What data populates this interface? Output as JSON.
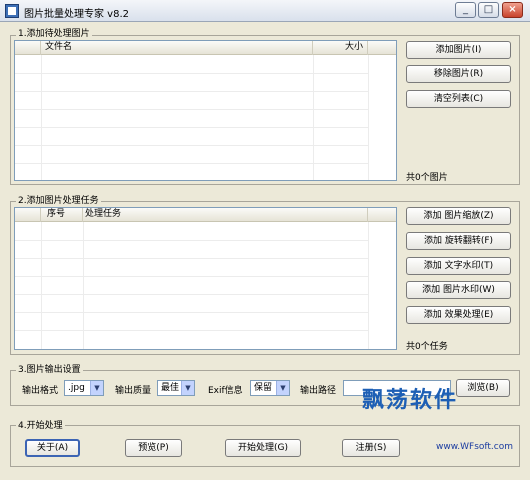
{
  "window": {
    "title": "图片批量处理专家 v8.2",
    "min": "_",
    "max": "□",
    "close": "×"
  },
  "section1": {
    "label": "1.添加待处理图片",
    "columns": [
      "文件名",
      "大小"
    ],
    "buttons": [
      "添加图片(I)",
      "移除图片(R)",
      "清空列表(C)"
    ],
    "count": "共0个图片"
  },
  "section2": {
    "label": "2.添加图片处理任务",
    "columns": [
      "序号",
      "处理任务"
    ],
    "buttons": [
      "添加 图片缩放(Z)",
      "添加 旋转翻转(F)",
      "添加 文字水印(T)",
      "添加 图片水印(W)",
      "添加 效果处理(E)"
    ],
    "count": "共0个任务"
  },
  "section3": {
    "label": "3.图片输出设置",
    "format_label": "输出格式",
    "format_value": ".jpg",
    "quality_label": "输出质量",
    "quality_value": "最佳",
    "exif_label": "Exif信息",
    "exif_value": "保留",
    "path_label": "输出路径",
    "path_value": "",
    "browse": "浏览(B)"
  },
  "section4": {
    "label": "4.开始处理",
    "buttons": [
      "关于(A)",
      "预览(P)",
      "开始处理(G)",
      "注册(S)"
    ],
    "link": "www.WFsoft.com"
  },
  "watermark": "飘荡软件"
}
